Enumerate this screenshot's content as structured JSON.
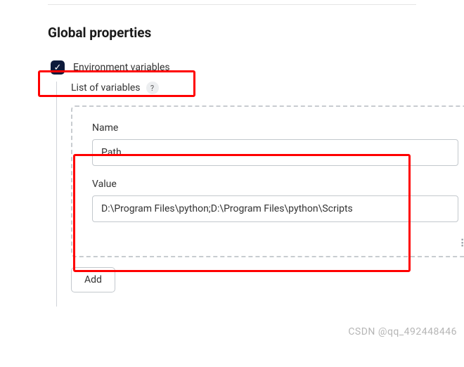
{
  "section": {
    "title": "Global properties"
  },
  "checkbox": {
    "label": "Environment variables",
    "checked": true
  },
  "list": {
    "label": "List of variables"
  },
  "fields": {
    "name": {
      "label": "Name",
      "value": "Path"
    },
    "value": {
      "label": "Value",
      "value": "D:\\Program Files\\python;D:\\Program Files\\python\\Scripts"
    }
  },
  "buttons": {
    "add": "Add"
  },
  "watermark": "CSDN @qq_492448446"
}
